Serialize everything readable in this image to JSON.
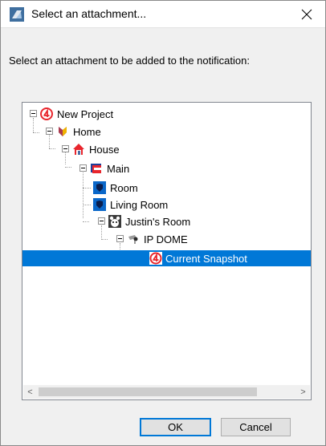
{
  "window": {
    "title": "Select an attachment...",
    "close_glyph": "✕"
  },
  "prompt": "Select an attachment to be added to the notification:",
  "tree": {
    "nodes": [
      {
        "label": "New Project",
        "icon": "project-logo-icon"
      },
      {
        "label": "Home",
        "icon": "home-icon"
      },
      {
        "label": "House",
        "icon": "house-icon"
      },
      {
        "label": "Main",
        "icon": "floor-icon"
      },
      {
        "label": "Room",
        "icon": "room-shield-icon"
      },
      {
        "label": "Living Room",
        "icon": "room-shield-icon"
      },
      {
        "label": "Justin's Room",
        "icon": "bear-room-icon"
      },
      {
        "label": "IP DOME",
        "icon": "camera-icon"
      },
      {
        "label": "Current Snapshot",
        "icon": "snapshot-logo-icon",
        "selected": true
      }
    ]
  },
  "scrollbar": {
    "left_arrow": "<",
    "right_arrow": ">"
  },
  "buttons": {
    "ok": "OK",
    "cancel": "Cancel"
  },
  "colors": {
    "selection": "#0078d7",
    "brand_red": "#e8262d"
  }
}
